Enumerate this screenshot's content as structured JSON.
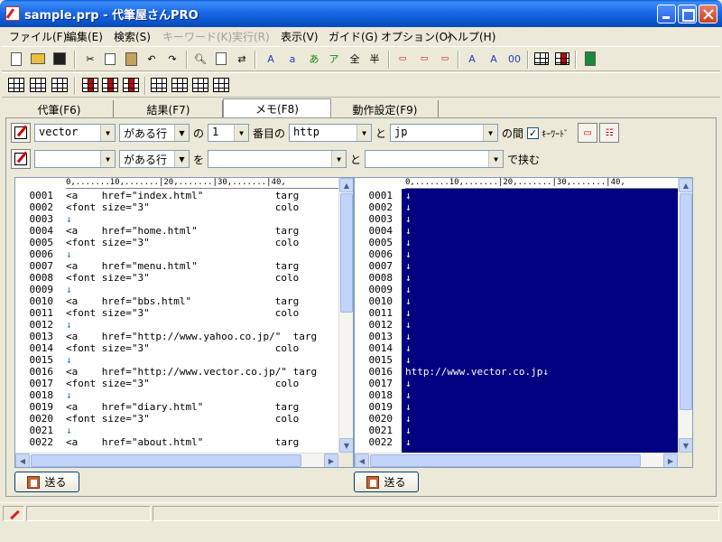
{
  "window": {
    "title": "sample.prp - 代筆屋さんPRO"
  },
  "menu": [
    {
      "label": "ファイル(F)",
      "disabled": false
    },
    {
      "label": "編集(E)",
      "disabled": false
    },
    {
      "label": "検索(S)",
      "disabled": false
    },
    {
      "label": "キーワード(K)",
      "disabled": true
    },
    {
      "label": "実行(R)",
      "disabled": true
    },
    {
      "label": "表示(V)",
      "disabled": false
    },
    {
      "label": "ガイド(G)",
      "disabled": false
    },
    {
      "label": "オプション(O)",
      "disabled": false
    },
    {
      "label": "ヘルプ(H)",
      "disabled": false
    }
  ],
  "toolbar1": {
    "new_icon": "new-file-icon",
    "open_icon": "open-folder-icon",
    "save_icon": "save-disk-icon",
    "cut_icon": "cut-icon",
    "copy_icon": "copy-icon",
    "paste_icon": "paste-icon",
    "undo_icon": "undo-icon",
    "redo_icon": "redo-icon",
    "find_icon": "find-icon",
    "findnext_icon": "find-next-icon",
    "replace_icon": "replace-icon",
    "glyphs": [
      "A",
      "a",
      "あ",
      "ア",
      "全",
      "半"
    ],
    "spacing_glyphs": [
      "A",
      "A",
      "00"
    ]
  },
  "tabs": [
    {
      "label": "代筆(F6)",
      "active": false
    },
    {
      "label": "結果(F7)",
      "active": false
    },
    {
      "label": "メモ(F8)",
      "active": true
    },
    {
      "label": "動作設定(F9)",
      "active": false
    }
  ],
  "search_row": {
    "field1": "vector",
    "cond1": "がある行",
    "label_no": "の",
    "index": "1",
    "label_banme": "番目の",
    "from": "http",
    "label_to": "と",
    "to": "jp",
    "label_between": "の間",
    "keyword_checked": "✓",
    "keyword_label": "ｷｰﾜｰﾄﾞ"
  },
  "replace_row": {
    "field1": "",
    "cond1": "がある行",
    "label_wo": "を",
    "value1": "",
    "label_to": "と",
    "value2": "",
    "label_enclose": "で挟む"
  },
  "left_editor": {
    "ruler": "0,.......10,.......|20,.......|30,.......|40,",
    "lines": [
      {
        "no": "0001",
        "text": "<a    href=\"index.html\"            targ"
      },
      {
        "no": "0002",
        "text": "<font size=\"3\"                     colo"
      },
      {
        "no": "0003",
        "text": "↓"
      },
      {
        "no": "0004",
        "text": "<a    href=\"home.html\"             targ"
      },
      {
        "no": "0005",
        "text": "<font size=\"3\"                     colo"
      },
      {
        "no": "0006",
        "text": "↓"
      },
      {
        "no": "0007",
        "text": "<a    href=\"menu.html\"             targ"
      },
      {
        "no": "0008",
        "text": "<font size=\"3\"                     colo"
      },
      {
        "no": "0009",
        "text": "↓"
      },
      {
        "no": "0010",
        "text": "<a    href=\"bbs.html\"              targ"
      },
      {
        "no": "0011",
        "text": "<font size=\"3\"                     colo"
      },
      {
        "no": "0012",
        "text": "↓"
      },
      {
        "no": "0013",
        "text": "<a    href=\"http://www.yahoo.co.jp/\"  targ"
      },
      {
        "no": "0014",
        "text": "<font size=\"3\"                     colo"
      },
      {
        "no": "0015",
        "text": "↓"
      },
      {
        "no": "0016",
        "text": "<a    href=\"http://www.vector.co.jp/\" targ"
      },
      {
        "no": "0017",
        "text": "<font size=\"3\"                     colo"
      },
      {
        "no": "0018",
        "text": "↓"
      },
      {
        "no": "0019",
        "text": "<a    href=\"diary.html\"            targ"
      },
      {
        "no": "0020",
        "text": "<font size=\"3\"                     colo"
      },
      {
        "no": "0021",
        "text": "↓"
      },
      {
        "no": "0022",
        "text": "<a    href=\"about.html\"            targ"
      }
    ]
  },
  "right_editor": {
    "ruler": "0,.......10,.......|20,.......|30,.......|40,",
    "lines": [
      {
        "no": "0001",
        "text": "↓"
      },
      {
        "no": "0002",
        "text": "↓"
      },
      {
        "no": "0003",
        "text": "↓"
      },
      {
        "no": "0004",
        "text": "↓"
      },
      {
        "no": "0005",
        "text": "↓"
      },
      {
        "no": "0006",
        "text": "↓"
      },
      {
        "no": "0007",
        "text": "↓"
      },
      {
        "no": "0008",
        "text": "↓"
      },
      {
        "no": "0009",
        "text": "↓"
      },
      {
        "no": "0010",
        "text": "↓"
      },
      {
        "no": "0011",
        "text": "↓"
      },
      {
        "no": "0012",
        "text": "↓"
      },
      {
        "no": "0013",
        "text": "↓"
      },
      {
        "no": "0014",
        "text": "↓"
      },
      {
        "no": "0015",
        "text": "↓"
      },
      {
        "no": "0016",
        "text": "http://www.vector.co.jp↓"
      },
      {
        "no": "0017",
        "text": "↓"
      },
      {
        "no": "0018",
        "text": "↓"
      },
      {
        "no": "0019",
        "text": "↓"
      },
      {
        "no": "0020",
        "text": "↓"
      },
      {
        "no": "0021",
        "text": "↓"
      },
      {
        "no": "0022",
        "text": "↓"
      }
    ]
  },
  "buttons": {
    "send_left": "送る",
    "send_right": "送る"
  },
  "colors": {
    "selection_bg": "#000080",
    "titlebar": "#0a52c8"
  }
}
